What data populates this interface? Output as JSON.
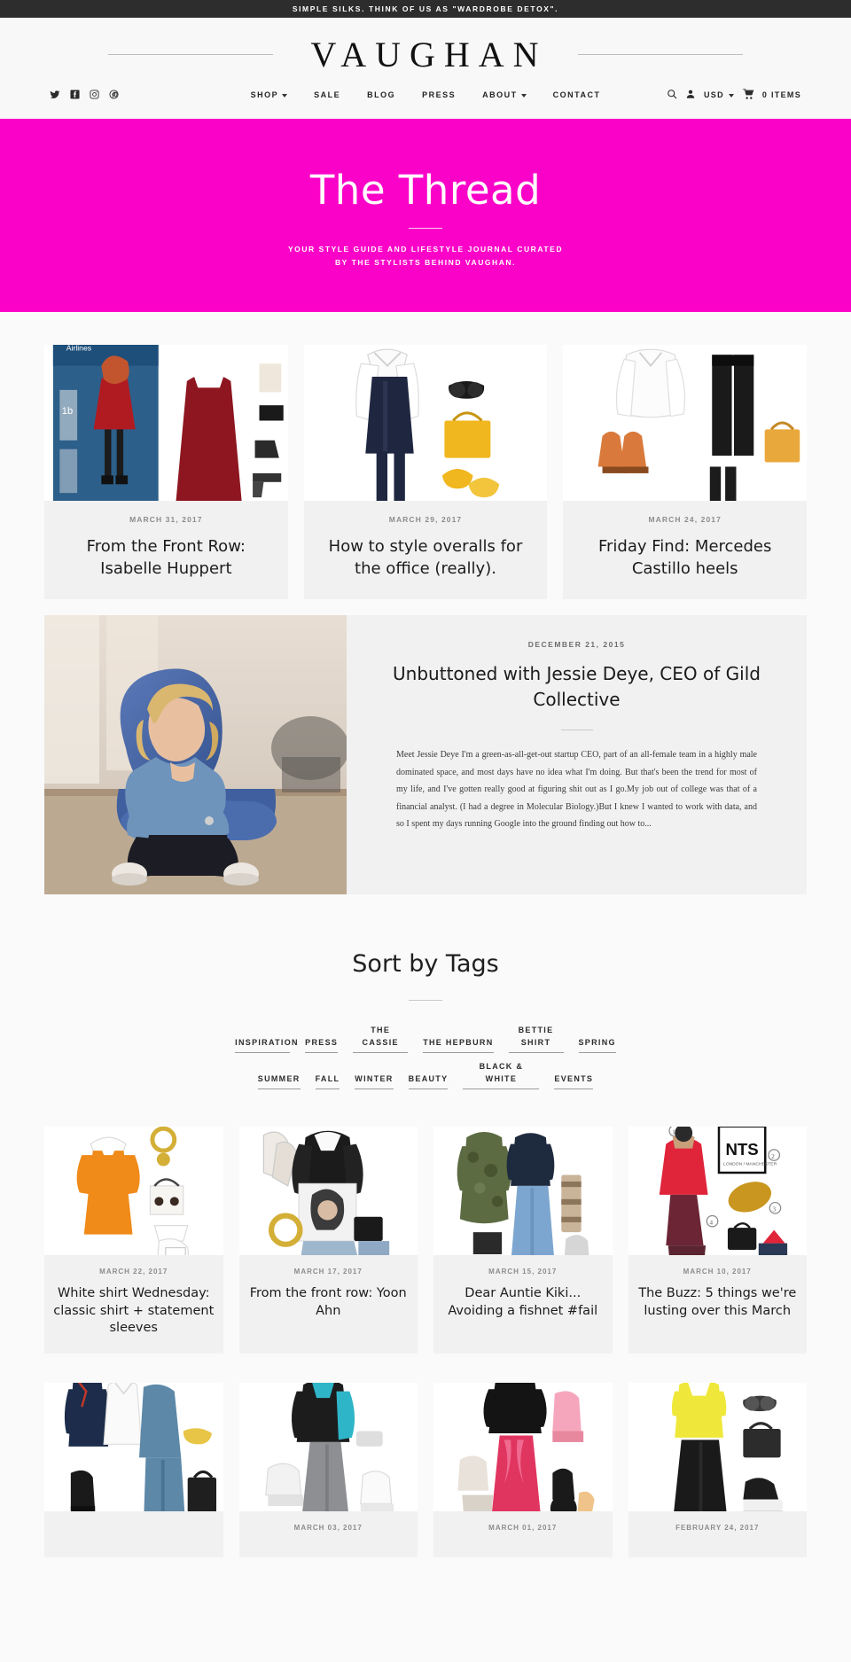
{
  "announcement": "SIMPLE SILKS. THINK OF US AS \"WARDROBE DETOX\".",
  "header": {
    "brand": "VAUGHAN",
    "social": [
      {
        "name": "twitter-icon",
        "label": "Twitter"
      },
      {
        "name": "facebook-icon",
        "label": "Facebook"
      },
      {
        "name": "instagram-icon",
        "label": "Instagram"
      },
      {
        "name": "pinterest-icon",
        "label": "Pinterest"
      }
    ],
    "nav": [
      {
        "label": "SHOP",
        "caret": true
      },
      {
        "label": "SALE",
        "caret": false
      },
      {
        "label": "BLOG",
        "caret": false
      },
      {
        "label": "PRESS",
        "caret": false
      },
      {
        "label": "ABOUT",
        "caret": true
      },
      {
        "label": "CONTACT",
        "caret": false
      }
    ],
    "utility": {
      "search_icon": "search-icon",
      "account_icon": "account-icon",
      "currency": "USD",
      "cart_icon": "cart-icon",
      "cart_label": "0 ITEMS"
    }
  },
  "hero": {
    "title": "The Thread",
    "subtitle": "YOUR STYLE GUIDE AND LIFESTYLE JOURNAL CURATED\nBY THE STYLISTS BEHIND VAUGHAN.",
    "subtitle_line1": "YOUR STYLE GUIDE AND LIFESTYLE JOURNAL CURATED",
    "subtitle_line2": "BY THE STYLISTS BEHIND VAUGHAN.",
    "background_color": "#fb02c8"
  },
  "top_posts": [
    {
      "date": "MARCH 31, 2017",
      "title": "From the Front Row: Isabelle Huppert"
    },
    {
      "date": "MARCH 29, 2017",
      "title": "How to style overalls for the office (really)."
    },
    {
      "date": "MARCH 24, 2017",
      "title": "Friday Find: Mercedes Castillo heels"
    }
  ],
  "featured": {
    "date": "DECEMBER 21, 2015",
    "title": "Unbuttoned with Jessie Deye, CEO of Gild Collective",
    "excerpt": "Meet Jessie Deye I'm a green-as-all-get-out startup CEO, part of an all-female team in a highly male dominated space, and most days have no idea what I'm doing. But that's been the trend for most of my life, and I've gotten really good at figuring shit out as I go.My job out of college was that of a financial analyst. (I had a degree in Molecular Biology.)But I knew I wanted to work with data, and so I spent my days running Google into the ground finding out how to..."
  },
  "tags_section": {
    "heading": "Sort by Tags",
    "row1": [
      "INSPIRATION",
      "PRESS",
      "THE CASSIE",
      "THE HEPBURN",
      "BETTIE SHIRT",
      "SPRING"
    ],
    "row2": [
      "SUMMER",
      "FALL",
      "WINTER",
      "BEAUTY",
      "BLACK & WHITE",
      "EVENTS"
    ]
  },
  "grid_posts": [
    {
      "date": "MARCH 22, 2017",
      "title": "White shirt Wednesday: classic shirt + statement sleeves"
    },
    {
      "date": "MARCH 17, 2017",
      "title": "From the front row: Yoon Ahn"
    },
    {
      "date": "MARCH 15, 2017",
      "title": "Dear Auntie Kiki... Avoiding a fishnet #fail"
    },
    {
      "date": "MARCH 10, 2017",
      "title": "The Buzz: 5 things we're lusting over this March"
    }
  ],
  "grid_posts_row2": [
    {
      "date": "",
      "title": ""
    },
    {
      "date": "MARCH 03, 2017",
      "title": ""
    },
    {
      "date": "MARCH 01, 2017",
      "title": ""
    },
    {
      "date": "FEBRUARY 24, 2017",
      "title": ""
    }
  ]
}
